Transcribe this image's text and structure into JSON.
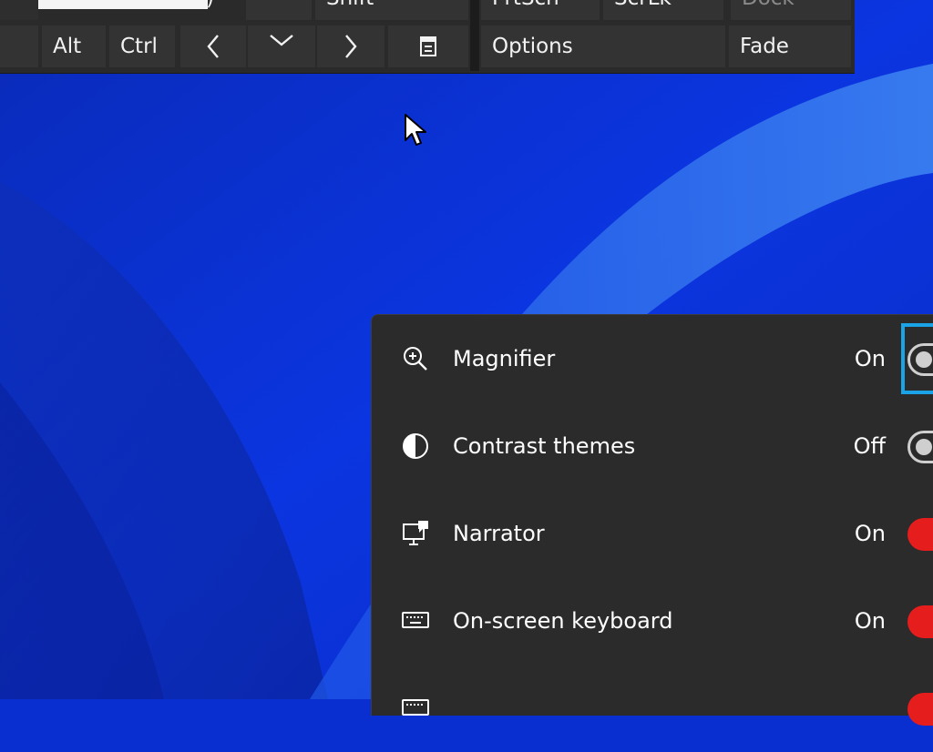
{
  "keyboard": {
    "row1": {
      "shift_label": "Shift",
      "prtscn_label": "PrtScn",
      "scrlk_label": "ScrLk",
      "dock_label": "Dock",
      "paren_label": ")"
    },
    "row2": {
      "alt_label": "Alt",
      "ctrl_label": "Ctrl",
      "left_label": "<",
      "down_label": "﹀",
      "right_label": ">",
      "options_label": "Options",
      "fade_label": "Fade"
    }
  },
  "accessibility_flyout": {
    "items": [
      {
        "label": "Magnifier",
        "state": "On",
        "icon": "magnifier-icon",
        "toggle": "off-style",
        "focused": true
      },
      {
        "label": "Contrast themes",
        "state": "Off",
        "icon": "contrast-icon",
        "toggle": "off-style"
      },
      {
        "label": "Narrator",
        "state": "On",
        "icon": "narrator-icon",
        "toggle": "on"
      },
      {
        "label": "On-screen keyboard",
        "state": "On",
        "icon": "keyboard-icon",
        "toggle": "on"
      },
      {
        "label": "",
        "state": "",
        "icon": "keyboard-icon",
        "toggle": "on"
      }
    ]
  },
  "colors": {
    "toggle_on": "#e61d1d",
    "focus": "#1aa3e6",
    "flyout_bg": "#2b2b2b",
    "wallpaper": "#0a2fd0"
  }
}
